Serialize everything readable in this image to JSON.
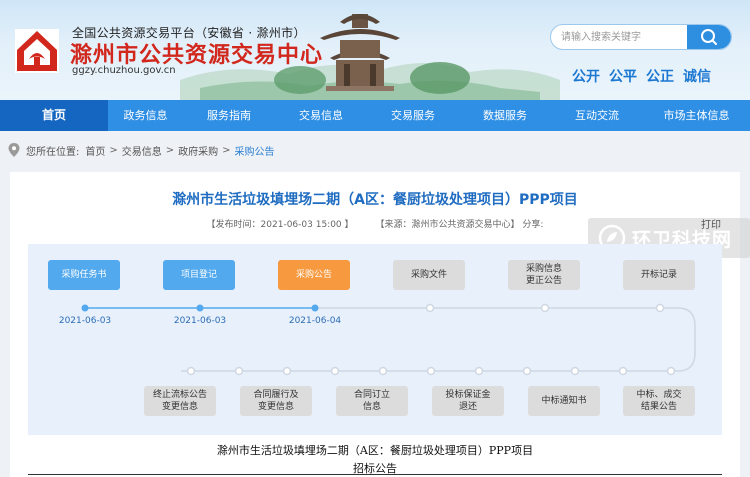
{
  "header": {
    "kicker": "全国公共资源交易平台（安徽省 · 滁州市）",
    "title": "滁州市公共资源交易中心",
    "url": "ggzy.chuzhou.gov.cn",
    "logo_icon": "house-emblem-icon",
    "search_placeholder": "请输入搜索关键字",
    "search_icon": "search-icon",
    "slogan": [
      "公开",
      "公平",
      "公正",
      "诚信"
    ],
    "brand_red": "#d1271d",
    "brand_blue": "#2f8fe4"
  },
  "nav": {
    "items": [
      "首页",
      "政务信息",
      "服务指南",
      "交易信息",
      "交易服务",
      "数据服务",
      "互动交流",
      "市场主体信息"
    ],
    "active_index": 0
  },
  "breadcrumb": {
    "prefix": "您所在位置:",
    "items": [
      "首页",
      "交易信息",
      "政府采购",
      "采购公告"
    ],
    "separator": ">"
  },
  "article": {
    "title": "滁州市生活垃圾填埋场二期（A区：餐厨垃圾处理项目）PPP项目",
    "publish_time": "【发布时间：2021-06-03 15:00 】",
    "source": "【来源：滁州市公共资源交易中心】",
    "share": "分享:",
    "print": "打印"
  },
  "watermark": {
    "text": "环卫科技网",
    "icon": "leaf-logo-icon"
  },
  "timeline": {
    "steps_top": [
      {
        "label": "采购任务书",
        "status": "done",
        "date": "2021-06-03"
      },
      {
        "label": "项目登记",
        "status": "done",
        "date": "2021-06-03"
      },
      {
        "label": "采购公告",
        "status": "current",
        "date": "2021-06-04"
      },
      {
        "label": "采购文件",
        "status": "todo",
        "date": ""
      },
      {
        "label": "采购信息\n更正公告",
        "status": "todo",
        "date": ""
      },
      {
        "label": "开标记录",
        "status": "todo",
        "date": ""
      }
    ],
    "steps_bottom": [
      {
        "label": "终止流标公告\n变更信息",
        "status": "todo"
      },
      {
        "label": "合同履行及\n变更信息",
        "status": "todo"
      },
      {
        "label": "合同订立\n信息",
        "status": "todo"
      },
      {
        "label": "投标保证金\n退还",
        "status": "todo"
      },
      {
        "label": "中标通知书",
        "status": "todo"
      },
      {
        "label": "中标、成交\n结果公告",
        "status": "todo"
      }
    ],
    "colors": {
      "done": "#52a9ee",
      "current": "#f7993e",
      "todo": "#dcdcdc"
    }
  },
  "document": {
    "title": "滁州市生活垃圾填埋场二期（A区：餐厨垃圾处理项目）PPP项目",
    "subtitle": "招标公告"
  }
}
